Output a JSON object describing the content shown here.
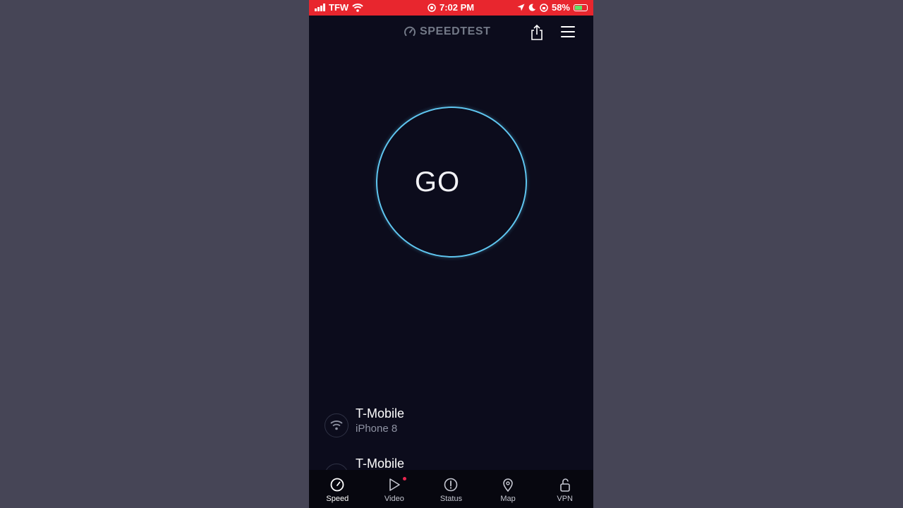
{
  "status_bar": {
    "carrier": "TFW",
    "time": "7:02 PM",
    "battery": "58%",
    "battery_level": 0.58
  },
  "header": {
    "logo_text": "SPEEDTEST",
    "share_icon": "share-icon",
    "menu_icon": "hamburger-menu-icon"
  },
  "main": {
    "go_label": "GO",
    "ring_color": "#5fc6f0"
  },
  "connections": [
    {
      "name": "T-Mobile",
      "device": "iPhone 8",
      "icon": "wifi-icon"
    },
    {
      "name": "T-Mobile",
      "icon": "server-icon"
    }
  ],
  "tabs": [
    {
      "label": "Speed",
      "icon": "speedometer-icon",
      "active": true
    },
    {
      "label": "Video",
      "icon": "play-icon",
      "badge": true
    },
    {
      "label": "Status",
      "icon": "alert-icon"
    },
    {
      "label": "Map",
      "icon": "map-pin-icon"
    },
    {
      "label": "VPN",
      "icon": "lock-icon"
    }
  ],
  "colors": {
    "status_bar": "#e8262e",
    "background": "#0c0c1c",
    "backdrop": "#464556",
    "badge": "#e8264f"
  }
}
